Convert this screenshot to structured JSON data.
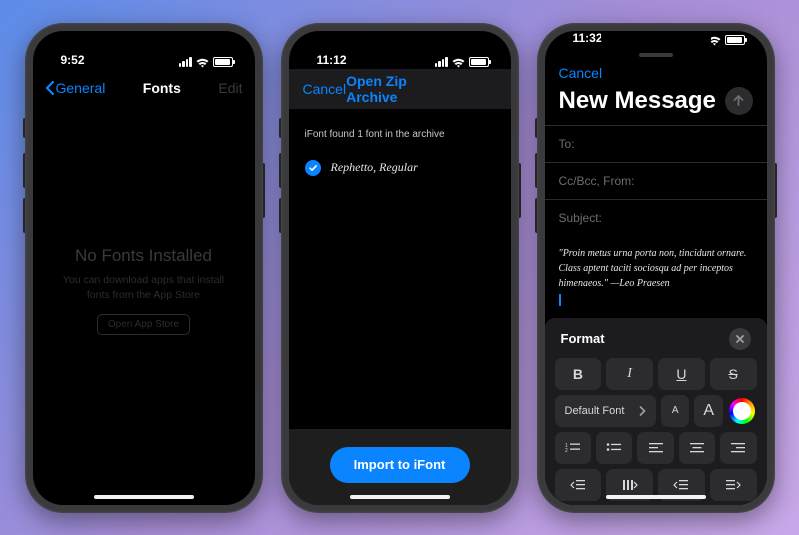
{
  "phone1": {
    "time": "9:52",
    "nav": {
      "back": "General",
      "title": "Fonts",
      "edit": "Edit"
    },
    "empty": {
      "title": "No Fonts Installed",
      "subtitle": "You can download apps that install fonts from the App Store",
      "button": "Open App Store"
    }
  },
  "phone2": {
    "time": "11:12",
    "nav": {
      "cancel": "Cancel",
      "title": "Open Zip Archive"
    },
    "message": "iFont found 1 font in the archive",
    "font_item": "Rephetto, Regular",
    "import_label": "Import to iFont"
  },
  "phone3": {
    "time": "11:32",
    "cancel": "Cancel",
    "title": "New Message",
    "fields": {
      "to": "To:",
      "ccbcc": "Cc/Bcc, From:",
      "subject": "Subject:"
    },
    "body": "\"Proin metus urna porta non, tincidunt ornare. Class aptent taciti sociosqu ad per inceptos himenaeos.\" —Leo Praesen",
    "format": {
      "title": "Format",
      "font_label": "Default Font",
      "b": "B",
      "i": "I",
      "u": "U",
      "s": "S",
      "size_small": "A",
      "size_large": "A"
    }
  }
}
